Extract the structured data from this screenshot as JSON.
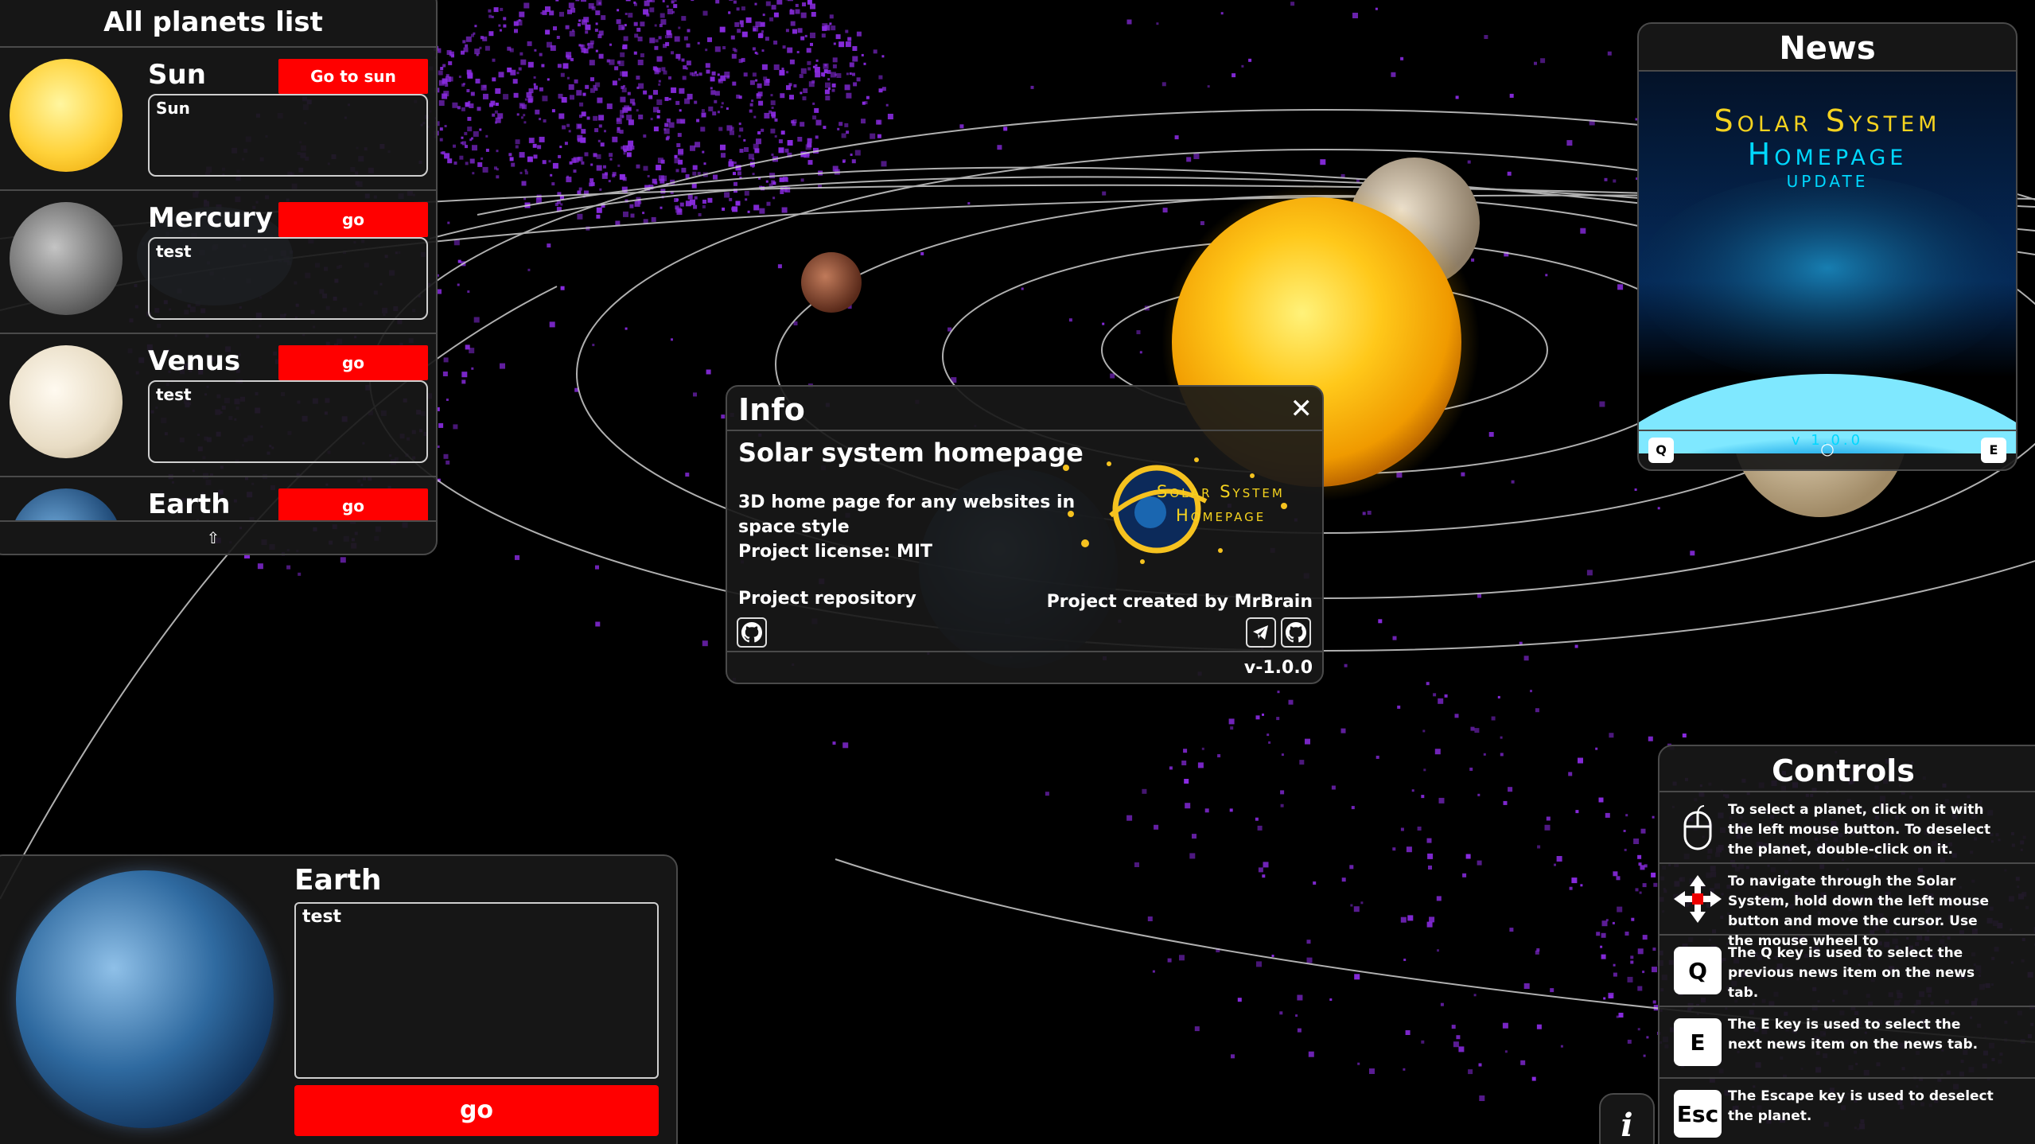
{
  "colors": {
    "accent_red": "#ff0000",
    "star_purple": "#8a2be2",
    "logo_gold": "#f5d31f",
    "logo_cyan": "#00d8ff"
  },
  "planets_list": {
    "title": "All planets list",
    "items": [
      {
        "name": "Sun",
        "button": "Go to sun",
        "description": "Sun"
      },
      {
        "name": "Mercury",
        "button": "go",
        "description": "test"
      },
      {
        "name": "Venus",
        "button": "go",
        "description": "test"
      },
      {
        "name": "Earth",
        "button": "go",
        "description": ""
      }
    ],
    "scroll_up_icon": "arrow-up-icon",
    "scroll_up_glyph": "⇧"
  },
  "news": {
    "title": "News",
    "poster": {
      "line1": "Solar System",
      "line2": "Homepage",
      "line3": "UPDATE",
      "version": "v 1.0.0"
    },
    "prev_key": "Q",
    "next_key": "E",
    "indicator": "○"
  },
  "info": {
    "title": "Info",
    "close_glyph": "✕",
    "project_title": "Solar system homepage",
    "description_lines": [
      "3D home page for any websites in",
      "space style",
      "Project license: MIT"
    ],
    "repo_label": "Project repository",
    "creator_label": "Project created by MrBrain",
    "logo_line1": "Solar System",
    "logo_line2": "Homepage",
    "version": "v-1.0.0"
  },
  "selected_planet": {
    "name": "Earth",
    "description": "test",
    "button": "go"
  },
  "controls": {
    "title": "Controls",
    "items": [
      {
        "icon": "mouse-icon",
        "key": "",
        "text": "To select a planet, click on it with the left mouse button. To deselect the planet, double-click on it."
      },
      {
        "icon": "move-arrows-icon",
        "key": "",
        "text": "To navigate through the Solar System, hold down the left mouse button and move the cursor. Use the mouse wheel to"
      },
      {
        "icon": "q-key-icon",
        "key": "Q",
        "text": "The Q key is used to select the previous news item on the news tab."
      },
      {
        "icon": "e-key-icon",
        "key": "E",
        "text": "The E key is used to select the next news item on the news tab."
      },
      {
        "icon": "esc-key-icon",
        "key": "Esc",
        "text": "The Escape key is used to deselect the planet."
      }
    ]
  },
  "info_toggle": {
    "icon": "info-icon",
    "glyph": "i"
  }
}
